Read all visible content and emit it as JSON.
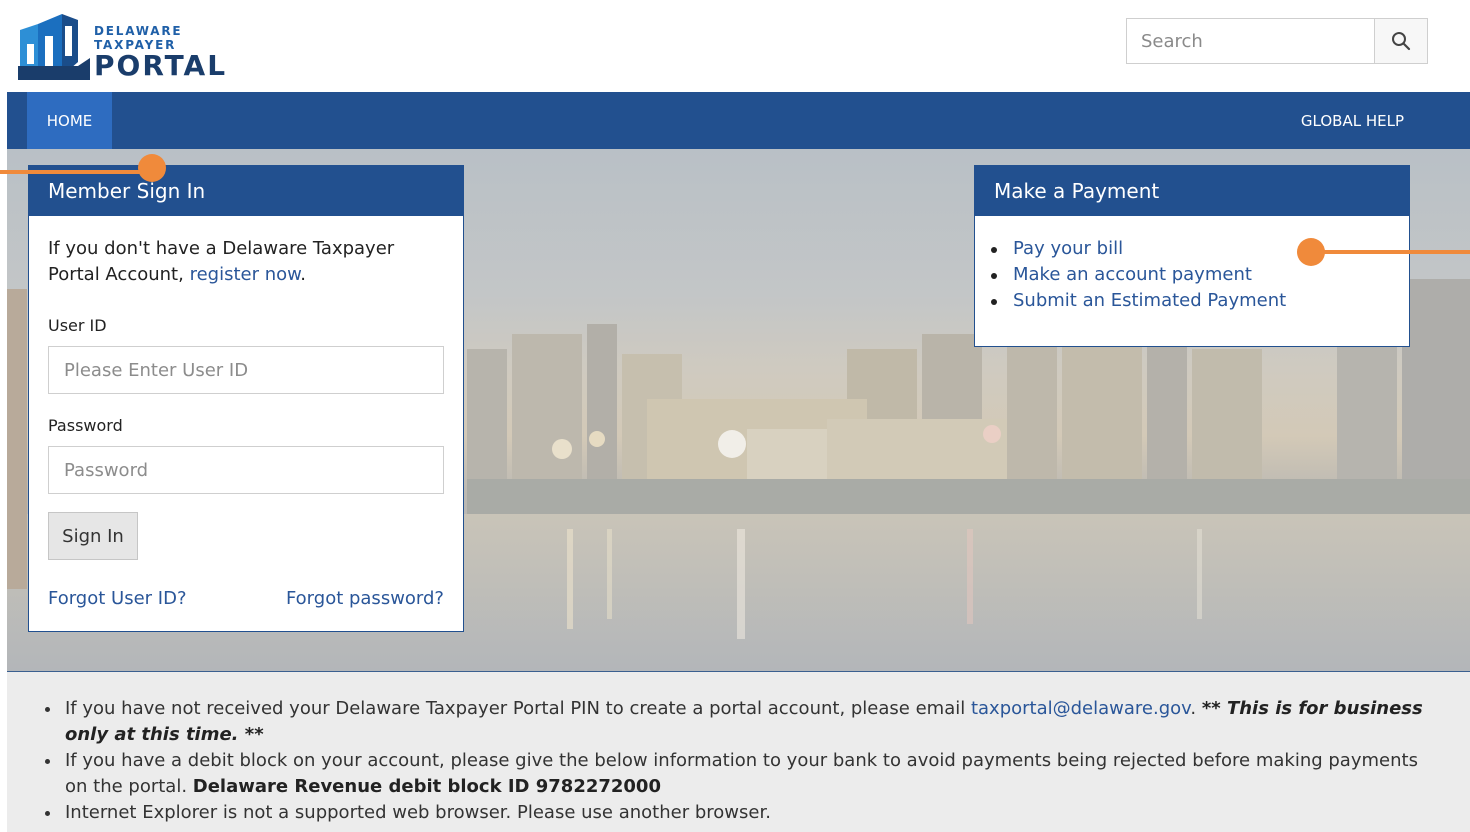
{
  "header": {
    "logo": {
      "line1": "DELAWARE",
      "line2": "TAXPAYER",
      "line3": "PORTAL"
    },
    "search": {
      "placeholder": "Search",
      "icon": "search-icon"
    }
  },
  "nav": {
    "home": "HOME",
    "global_help": "GLOBAL HELP"
  },
  "signin": {
    "title": "Member Sign In",
    "intro_text": "If you don't have a Delaware Taxpayer Portal Account, ",
    "register_link": "register now",
    "intro_end": ".",
    "userid_label": "User ID",
    "userid_placeholder": "Please Enter User ID",
    "password_label": "Password",
    "password_placeholder": "Password",
    "signin_button": "Sign In",
    "forgot_userid": "Forgot User ID?",
    "forgot_password": "Forgot password?"
  },
  "payment": {
    "title": "Make a Payment",
    "links": [
      "Pay your bill",
      "Make an account payment",
      "Submit an Estimated Payment"
    ]
  },
  "notices": {
    "item1_text": "If you have not received your Delaware Taxpayer Portal PIN to create a portal account, please email ",
    "item1_email": "taxportal@delaware.gov",
    "item1_sep": ". ",
    "item1_bold": "** This is for business only at this time. **",
    "item2_text": "If you have a debit block on your account, please give the below information to your bank to avoid payments being rejected before making payments on the portal. ",
    "item2_bold": "Delaware Revenue debit block ID 9782272000",
    "item3_text": "Internet Explorer is not a supported web browser. Please use another browser."
  },
  "colors": {
    "nav_bg": "#22508f",
    "nav_active": "#2e6cc0",
    "link": "#2a5699",
    "marker": "#f08a3b"
  }
}
